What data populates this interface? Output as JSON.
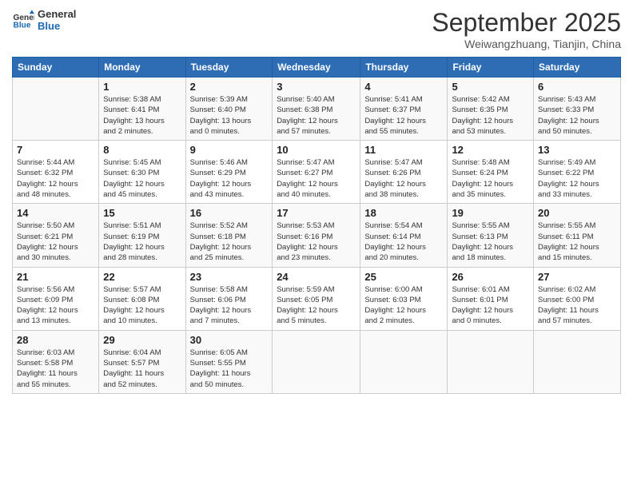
{
  "header": {
    "logo_line1": "General",
    "logo_line2": "Blue",
    "month": "September 2025",
    "location": "Weiwangzhuang, Tianjin, China"
  },
  "days_of_week": [
    "Sunday",
    "Monday",
    "Tuesday",
    "Wednesday",
    "Thursday",
    "Friday",
    "Saturday"
  ],
  "weeks": [
    [
      {
        "day": "",
        "info": ""
      },
      {
        "day": "1",
        "info": "Sunrise: 5:38 AM\nSunset: 6:41 PM\nDaylight: 13 hours\nand 2 minutes."
      },
      {
        "day": "2",
        "info": "Sunrise: 5:39 AM\nSunset: 6:40 PM\nDaylight: 13 hours\nand 0 minutes."
      },
      {
        "day": "3",
        "info": "Sunrise: 5:40 AM\nSunset: 6:38 PM\nDaylight: 12 hours\nand 57 minutes."
      },
      {
        "day": "4",
        "info": "Sunrise: 5:41 AM\nSunset: 6:37 PM\nDaylight: 12 hours\nand 55 minutes."
      },
      {
        "day": "5",
        "info": "Sunrise: 5:42 AM\nSunset: 6:35 PM\nDaylight: 12 hours\nand 53 minutes."
      },
      {
        "day": "6",
        "info": "Sunrise: 5:43 AM\nSunset: 6:33 PM\nDaylight: 12 hours\nand 50 minutes."
      }
    ],
    [
      {
        "day": "7",
        "info": "Sunrise: 5:44 AM\nSunset: 6:32 PM\nDaylight: 12 hours\nand 48 minutes."
      },
      {
        "day": "8",
        "info": "Sunrise: 5:45 AM\nSunset: 6:30 PM\nDaylight: 12 hours\nand 45 minutes."
      },
      {
        "day": "9",
        "info": "Sunrise: 5:46 AM\nSunset: 6:29 PM\nDaylight: 12 hours\nand 43 minutes."
      },
      {
        "day": "10",
        "info": "Sunrise: 5:47 AM\nSunset: 6:27 PM\nDaylight: 12 hours\nand 40 minutes."
      },
      {
        "day": "11",
        "info": "Sunrise: 5:47 AM\nSunset: 6:26 PM\nDaylight: 12 hours\nand 38 minutes."
      },
      {
        "day": "12",
        "info": "Sunrise: 5:48 AM\nSunset: 6:24 PM\nDaylight: 12 hours\nand 35 minutes."
      },
      {
        "day": "13",
        "info": "Sunrise: 5:49 AM\nSunset: 6:22 PM\nDaylight: 12 hours\nand 33 minutes."
      }
    ],
    [
      {
        "day": "14",
        "info": "Sunrise: 5:50 AM\nSunset: 6:21 PM\nDaylight: 12 hours\nand 30 minutes."
      },
      {
        "day": "15",
        "info": "Sunrise: 5:51 AM\nSunset: 6:19 PM\nDaylight: 12 hours\nand 28 minutes."
      },
      {
        "day": "16",
        "info": "Sunrise: 5:52 AM\nSunset: 6:18 PM\nDaylight: 12 hours\nand 25 minutes."
      },
      {
        "day": "17",
        "info": "Sunrise: 5:53 AM\nSunset: 6:16 PM\nDaylight: 12 hours\nand 23 minutes."
      },
      {
        "day": "18",
        "info": "Sunrise: 5:54 AM\nSunset: 6:14 PM\nDaylight: 12 hours\nand 20 minutes."
      },
      {
        "day": "19",
        "info": "Sunrise: 5:55 AM\nSunset: 6:13 PM\nDaylight: 12 hours\nand 18 minutes."
      },
      {
        "day": "20",
        "info": "Sunrise: 5:55 AM\nSunset: 6:11 PM\nDaylight: 12 hours\nand 15 minutes."
      }
    ],
    [
      {
        "day": "21",
        "info": "Sunrise: 5:56 AM\nSunset: 6:09 PM\nDaylight: 12 hours\nand 13 minutes."
      },
      {
        "day": "22",
        "info": "Sunrise: 5:57 AM\nSunset: 6:08 PM\nDaylight: 12 hours\nand 10 minutes."
      },
      {
        "day": "23",
        "info": "Sunrise: 5:58 AM\nSunset: 6:06 PM\nDaylight: 12 hours\nand 7 minutes."
      },
      {
        "day": "24",
        "info": "Sunrise: 5:59 AM\nSunset: 6:05 PM\nDaylight: 12 hours\nand 5 minutes."
      },
      {
        "day": "25",
        "info": "Sunrise: 6:00 AM\nSunset: 6:03 PM\nDaylight: 12 hours\nand 2 minutes."
      },
      {
        "day": "26",
        "info": "Sunrise: 6:01 AM\nSunset: 6:01 PM\nDaylight: 12 hours\nand 0 minutes."
      },
      {
        "day": "27",
        "info": "Sunrise: 6:02 AM\nSunset: 6:00 PM\nDaylight: 11 hours\nand 57 minutes."
      }
    ],
    [
      {
        "day": "28",
        "info": "Sunrise: 6:03 AM\nSunset: 5:58 PM\nDaylight: 11 hours\nand 55 minutes."
      },
      {
        "day": "29",
        "info": "Sunrise: 6:04 AM\nSunset: 5:57 PM\nDaylight: 11 hours\nand 52 minutes."
      },
      {
        "day": "30",
        "info": "Sunrise: 6:05 AM\nSunset: 5:55 PM\nDaylight: 11 hours\nand 50 minutes."
      },
      {
        "day": "",
        "info": ""
      },
      {
        "day": "",
        "info": ""
      },
      {
        "day": "",
        "info": ""
      },
      {
        "day": "",
        "info": ""
      }
    ]
  ]
}
